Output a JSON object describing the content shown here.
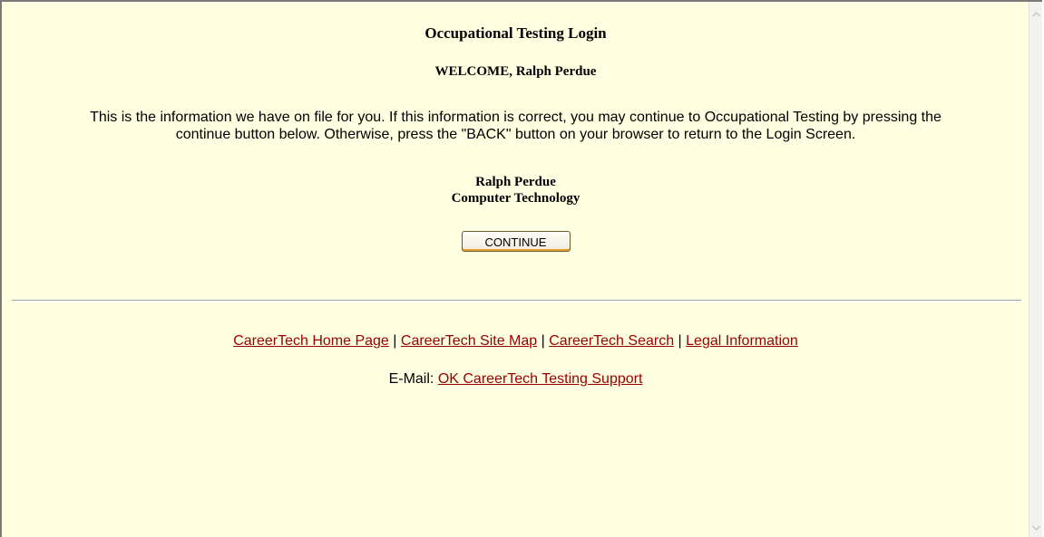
{
  "page": {
    "title": "Occupational Testing Login",
    "welcome": "WELCOME, Ralph Perdue",
    "info_line_1": "This is the information we have on file for you. If this information is correct, you may continue to Occupational Testing by pressing the",
    "info_line_2": "continue button below. Otherwise, press the \"BACK\" button on your browser to return to the Login Screen.",
    "student_name": "Ralph Perdue",
    "program": "Computer Technology",
    "continue_label": "CONTINUE"
  },
  "footer": {
    "links": [
      {
        "label": "CareerTech Home Page"
      },
      {
        "label": "CareerTech Site Map"
      },
      {
        "label": "CareerTech Search"
      },
      {
        "label": "Legal Information"
      }
    ],
    "separator": "|",
    "email_label": "E-Mail:",
    "email_link": "OK CareerTech Testing Support"
  },
  "colors": {
    "background": "#ffffe1",
    "link": "#990000",
    "button_accent": "#e3a22e"
  },
  "scrollbar": {
    "up_icon": "arrow-up-icon",
    "down_icon": "arrow-down-icon"
  }
}
